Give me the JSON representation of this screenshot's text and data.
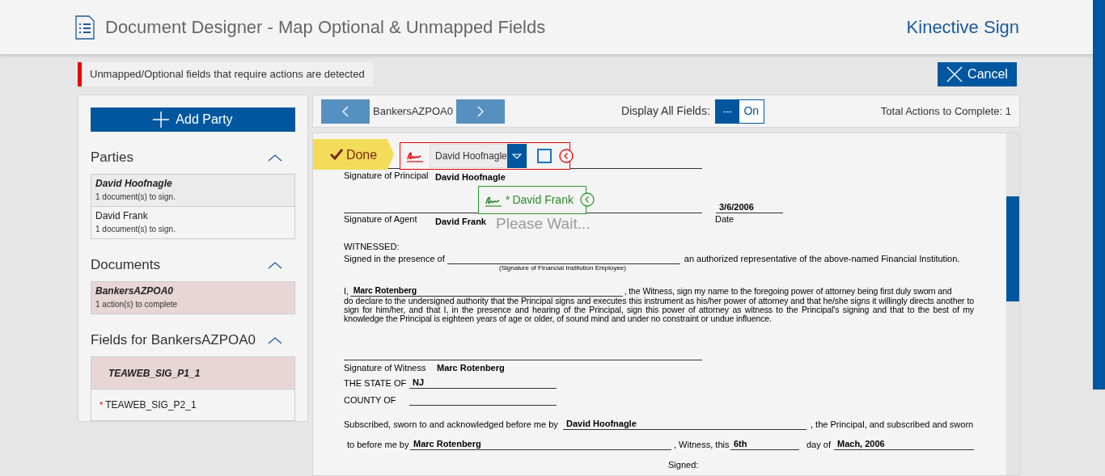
{
  "header": {
    "title": "Document Designer - Map Optional & Unmapped Fields",
    "brand": "Kinective Sign"
  },
  "required_mark": "*",
  "alert": "Unmapped/Optional fields that require actions are detected",
  "cancel_button": "Cancel",
  "sidebar": {
    "add_party": "Add Party",
    "sections": [
      {
        "title": "Parties",
        "expanded": true,
        "items": [
          {
            "name": "David Hoofnagle",
            "detail": "1 document(s) to sign.",
            "selected": true,
            "flagged": false
          },
          {
            "name": "David Frank",
            "detail": "1 document(s) to sign.",
            "selected": false,
            "flagged": false
          }
        ]
      },
      {
        "title": "Documents",
        "expanded": true,
        "items": [
          {
            "name": "BankersAZPOA0",
            "detail": "1 action(s) to complete",
            "selected": true,
            "flagged": true
          }
        ]
      },
      {
        "title": "Fields for BankersAZPOA0",
        "expanded": true,
        "items": [
          {
            "name": "TEAWEB_SIG_P1_1",
            "selected": true,
            "flagged": true,
            "required": false
          },
          {
            "name": "TEAWEB_SIG_P2_1",
            "selected": false,
            "flagged": false,
            "required": true
          }
        ]
      }
    ]
  },
  "toolbar": {
    "document": "BankersAZPOA0",
    "display_all_label": "Display All Fields:",
    "toggle_off_label": "---",
    "toggle_on_label": "On",
    "display_all_on": true,
    "total_actions": "Total Actions to Complete: 1"
  },
  "overlay": {
    "done_button": "Done",
    "active_field": {
      "party": "David Hoofnagle",
      "checked": false
    },
    "other_field": {
      "label": "David Frank",
      "required": true
    },
    "please_wait": "Please Wait..."
  },
  "document": {
    "principal": {
      "label": "Signature of Principal",
      "value": "David Hoofnagle"
    },
    "agent": {
      "label": "Signature of Agent",
      "value": "David Frank"
    },
    "date": {
      "label": "Date",
      "value": "3/6/2006"
    },
    "witnessed": "WITNESSED:",
    "presence": {
      "before": "Signed in the presence of",
      "after": "an authorized representative of the above-named Financial Institution.",
      "caption": "(Signature of Financial Institution Employee)"
    },
    "witness_paragraph": {
      "prefix": "I,",
      "name": "Marc Rotenberg",
      "first_line": ", the Witness, sign my name to the foregoing power of attorney being first duly sworn and",
      "rest": "do declare to the undersigned authority that the Principal signs and executes this instrument as his/her power of attorney and that he/she signs it willingly directs another to sign for him/her, and that I, in the presence and hearing of the Principal, sign this power of attorney as witness to the Principal's signing and that to the best of my knowledge the Principal is eighteen years of age or older, of sound mind and under no constraint or undue influence."
    },
    "witness": {
      "label": "Signature of Witness",
      "value": "Marc Rotenberg"
    },
    "state": {
      "label": "THE STATE OF",
      "value": "NJ"
    },
    "county": {
      "label": "COUNTY OF"
    },
    "subscribed": {
      "before": "Subscribed, sworn to and acknowledged before me by",
      "value": "David Hoofnagle",
      "after": ", the Principal, and subscribed and sworn"
    },
    "sworn": {
      "before": "to before me by",
      "witness": "Marc Rotenberg",
      "middle": ", Witness, this",
      "day": "6th",
      "day_of": "day of",
      "month_year": "Mach, 2006"
    },
    "signed": "Signed:"
  }
}
